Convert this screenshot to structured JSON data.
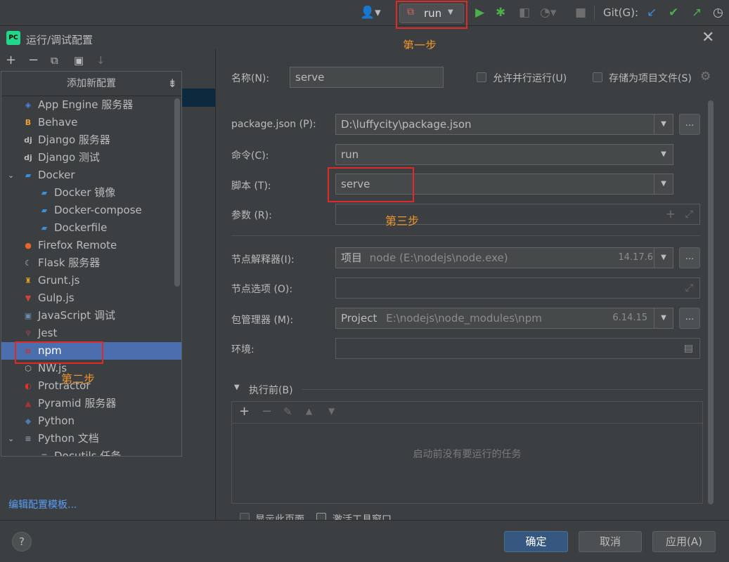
{
  "toolbar": {
    "run_config": "run",
    "git_label": "Git(G):"
  },
  "dialog": {
    "title": "运行/调试配置"
  },
  "annotations": {
    "step1": "第一步",
    "step2": "第二步",
    "step3": "第三步"
  },
  "popup": {
    "header": "添加新配置",
    "items": [
      {
        "label": "App Engine 服务器",
        "icon": "app-engine-icon",
        "color": "#4a86e8"
      },
      {
        "label": "Behave",
        "icon": "behave-icon",
        "color": "#f0a030"
      },
      {
        "label": "Django 服务器",
        "icon": "django-icon",
        "color": "#bbbbbb"
      },
      {
        "label": "Django 测试",
        "icon": "django-icon",
        "color": "#bbbbbb"
      },
      {
        "label": "Docker",
        "icon": "docker-icon",
        "color": "#3a8fd8"
      },
      {
        "label": "Docker 镜像",
        "icon": "docker-icon",
        "color": "#3a8fd8"
      },
      {
        "label": "Docker-compose",
        "icon": "docker-icon",
        "color": "#3a8fd8"
      },
      {
        "label": "Dockerfile",
        "icon": "docker-icon",
        "color": "#3a8fd8"
      },
      {
        "label": "Firefox Remote",
        "icon": "firefox-icon",
        "color": "#e8662a"
      },
      {
        "label": "Flask 服务器",
        "icon": "flask-icon",
        "color": "#bbbbbb"
      },
      {
        "label": "Grunt.js",
        "icon": "grunt-icon",
        "color": "#e0a020"
      },
      {
        "label": "Gulp.js",
        "icon": "gulp-icon",
        "color": "#d84040"
      },
      {
        "label": "JavaScript 调试",
        "icon": "js-debug-icon",
        "color": "#6a8caf"
      },
      {
        "label": "Jest",
        "icon": "jest-icon",
        "color": "#994455"
      },
      {
        "label": "npm",
        "icon": "npm-icon",
        "color": "#cc3333"
      },
      {
        "label": "NW.js",
        "icon": "nwjs-icon",
        "color": "#bbbbbb"
      },
      {
        "label": "Protractor",
        "icon": "protractor-icon",
        "color": "#e03030"
      },
      {
        "label": "Pyramid 服务器",
        "icon": "pyramid-icon",
        "color": "#aa3333"
      },
      {
        "label": "Python",
        "icon": "python-icon",
        "color": "#4a7ab0"
      },
      {
        "label": "Python 文档",
        "icon": "python-docs-icon",
        "color": "#8a9aaa"
      },
      {
        "label": "Docutils 任务",
        "icon": "docutils-icon",
        "color": "#8a9aaa"
      }
    ]
  },
  "left": {
    "edit_templates": "编辑配置模板..."
  },
  "form": {
    "name_label": "名称(N):",
    "name_value": "serve",
    "allow_parallel": "允许并行运行(U)",
    "store_as_file": "存储为项目文件(S)",
    "package_label": "package.json (P):",
    "package_value": "D:\\luffycity\\package.json",
    "command_label": "命令(C):",
    "command_value": "run",
    "script_label": "脚本 (T):",
    "script_value": "serve",
    "args_label": "参数 (R):",
    "node_interp_label": "节点解释器(I):",
    "node_interp_prefix": "项目",
    "node_interp_path": "node (E:\\nodejs\\node.exe)",
    "node_version": "14.17.6",
    "node_options_label": "节点选项 (O):",
    "pkg_manager_label": "包管理器 (M):",
    "pkg_manager_prefix": "Project",
    "pkg_manager_path": "E:\\nodejs\\node_modules\\npm",
    "npm_version": "6.14.15",
    "env_label": "环境:",
    "before_launch": "执行前(B)",
    "no_tasks": "启动前没有要运行的任务",
    "show_page": "显示此页面",
    "activate_tool": "激活工具窗口"
  },
  "buttons": {
    "ok": "确定",
    "cancel": "取消",
    "apply": "应用(A)",
    "help": "?"
  }
}
